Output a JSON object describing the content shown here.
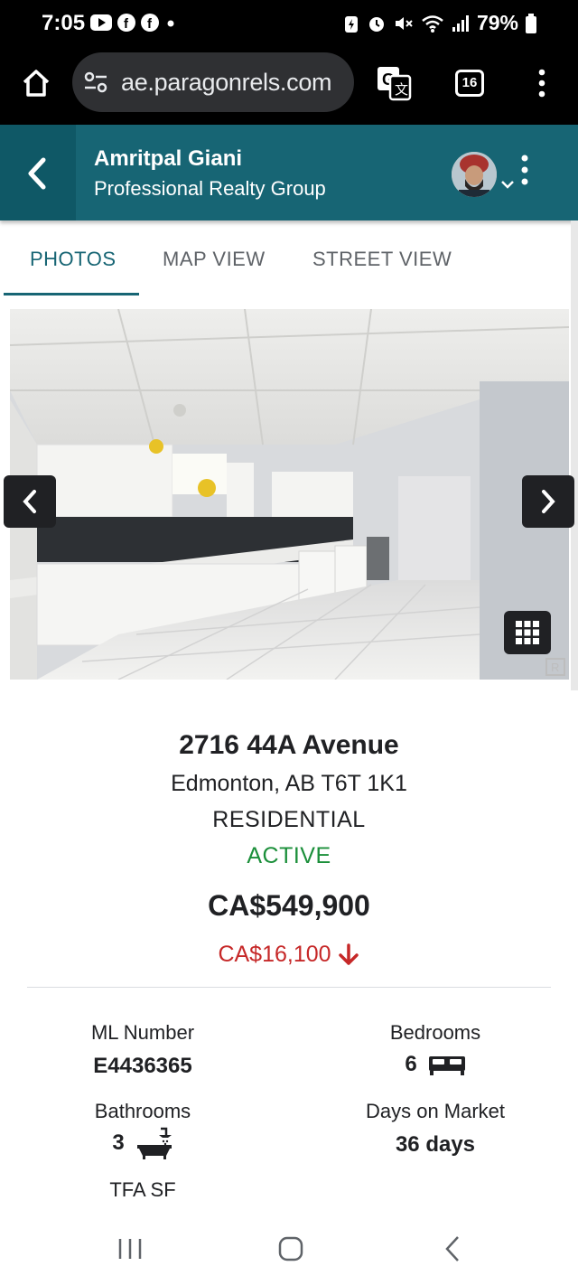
{
  "status_bar": {
    "time": "7:05",
    "battery": "79%",
    "left_icons": [
      "youtube-icon",
      "facebook-icon",
      "facebook-icon",
      "dot-icon"
    ],
    "right_icons": [
      "battery-saver-icon",
      "alarm-icon",
      "mute-icon",
      "wifi-icon",
      "signal-icon",
      "battery-icon"
    ]
  },
  "browser": {
    "url": "ae.paragonrels.com",
    "tab_count": "16"
  },
  "header": {
    "agent_name": "Amritpal Giani",
    "company": "Professional Realty Group"
  },
  "tabs": [
    {
      "label": "PHOTOS",
      "active": true
    },
    {
      "label": "MAP VIEW",
      "active": false
    },
    {
      "label": "STREET VIEW",
      "active": false
    }
  ],
  "listing": {
    "address_line1": "2716 44A Avenue",
    "address_line2": "Edmonton, AB T6T 1K1",
    "property_type": "RESIDENTIAL",
    "status": "ACTIVE",
    "price": "CA$549,900",
    "price_change": "CA$16,100"
  },
  "stats": {
    "ml_label": "ML Number",
    "ml_value": "E4436365",
    "bedrooms_label": "Bedrooms",
    "bedrooms_value": "6",
    "bathrooms_label": "Bathrooms",
    "bathrooms_value": "3",
    "dom_label": "Days on Market",
    "dom_value": "36 days",
    "tfa_label": "TFA SF"
  },
  "colors": {
    "header_teal": "#176574",
    "status_green": "#1b8f3a",
    "price_drop_red": "#c62828"
  }
}
